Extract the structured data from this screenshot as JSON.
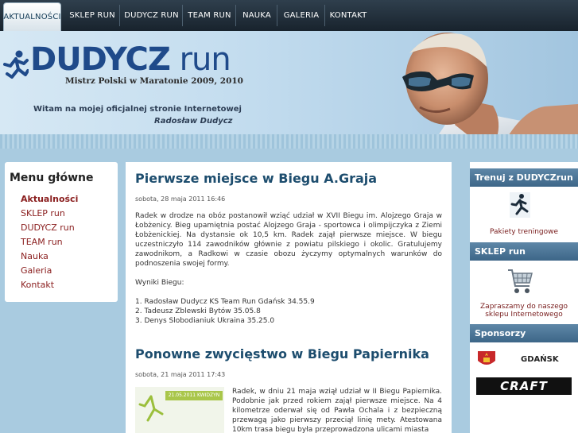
{
  "nav": {
    "tabs": [
      {
        "label": "AKTUALNOŚCI"
      },
      {
        "label": "SKLEP RUN"
      },
      {
        "label": "DUDYCZ RUN"
      },
      {
        "label": "TEAM RUN"
      },
      {
        "label": "NAUKA"
      },
      {
        "label": "GALERIA"
      },
      {
        "label": "KONTAKT"
      }
    ]
  },
  "header": {
    "logo_part1": "DUDYCZ",
    "logo_part2": "run",
    "subtitle": "Mistrz Polski w Maratonie 2009, 2010",
    "welcome": "Witam na mojej oficjalnej stronie Internetowej",
    "signature": "Radosław Dudycz"
  },
  "menu": {
    "title": "Menu główne",
    "items": [
      {
        "label": "Aktualności"
      },
      {
        "label": "SKLEP run"
      },
      {
        "label": "DUDYCZ run"
      },
      {
        "label": "TEAM run"
      },
      {
        "label": "Nauka"
      },
      {
        "label": "Galeria"
      },
      {
        "label": "Kontakt"
      }
    ]
  },
  "posts": [
    {
      "title": "Pierwsze miejsce w Biegu A.Graja",
      "date": "sobota, 28 maja 2011 16:46",
      "body": "Radek w drodze na obóz postanowił wziąć udział w XVII Biegu im. Alojzego Graja w Łobżenicy. Bieg upamiętnia postać Alojzego Graja - sportowca i olimpijczyka z Ziemi Łobżenickiej. Na dystansie ok 10,5 km. Radek zajął pierwsze miejsce. W biegu uczestniczyło 114 zawodników głównie z powiatu pilskiego i okolic. Gratulujemy zawodnikom, a Radkowi w czasie obozu życzymy optymalnych warunków do podnoszenia swojej formy.",
      "results_heading": "Wyniki Biegu:",
      "results": [
        "1. Radosław Dudycz KS Team Run Gdańsk 34.55.9",
        "2. Tadeusz Zblewski Bytów 35.05.8",
        "3. Denys Slobodianiuk Ukraina 35.25.0"
      ]
    },
    {
      "title": "Ponowne zwycięstwo w Biegu Papiernika",
      "date": "sobota, 21 maja 2011 17:43",
      "body": "Radek, w dniu 21 maja wziął udział w II Biegu Papiernika. Podobnie jak przed rokiem zajął pierwsze miejsce. Na 4 kilometrze oderwał się od Pawła Ochala i z bezpieczną przewagą jako pierwszy przeciął linię mety. Atestowana 10km trasa biegu była przeprowadzona ulicami miasta",
      "thumb_text": "21.05.2011 KWIDZYN"
    }
  ],
  "sidebar": {
    "trenuj": {
      "title": "Trenuj z DUDYCZrun",
      "link": "Pakiety treningowe"
    },
    "sklep": {
      "title": "SKLEP run",
      "link": "Zapraszamy do naszego sklepu Internetowego"
    },
    "sponsorzy": {
      "title": "Sponsorzy",
      "sponsor1": "GDAŃSK",
      "sponsor2": "CRAFT"
    }
  }
}
